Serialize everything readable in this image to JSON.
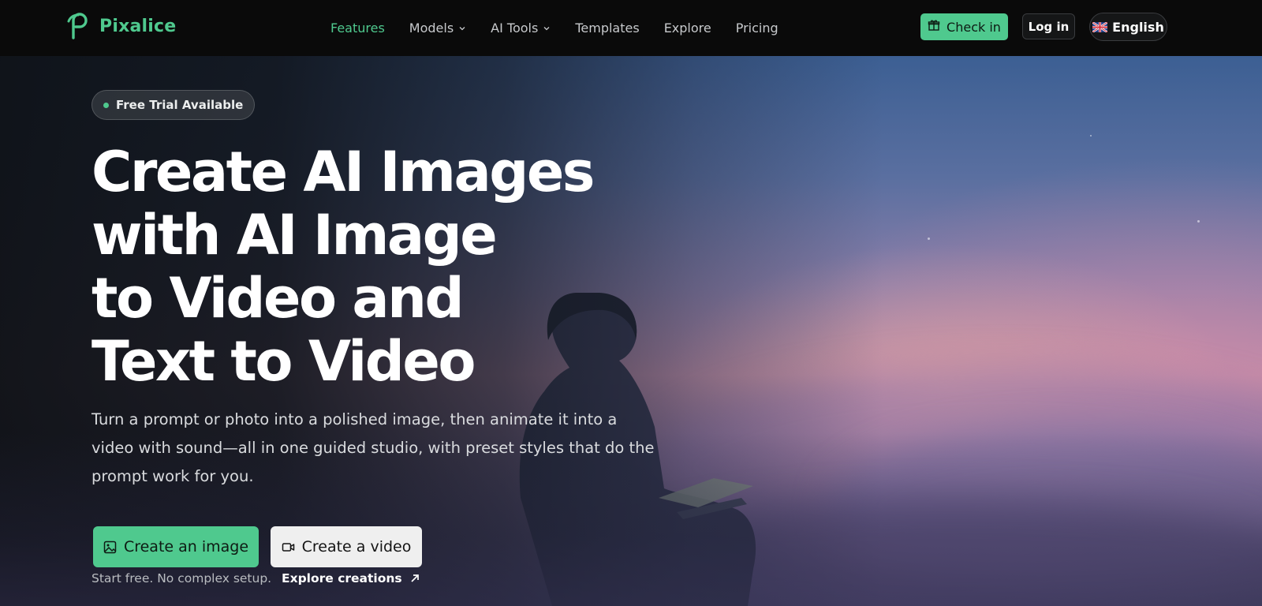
{
  "brand": {
    "name": "Pixalice",
    "accent": "#4fc98e"
  },
  "nav": {
    "links": [
      {
        "label": "Features",
        "active": true,
        "dropdown": false
      },
      {
        "label": "Models",
        "active": false,
        "dropdown": true
      },
      {
        "label": "AI Tools",
        "active": false,
        "dropdown": true
      },
      {
        "label": "Templates",
        "active": false,
        "dropdown": false
      },
      {
        "label": "Explore",
        "active": false,
        "dropdown": false
      },
      {
        "label": "Pricing",
        "active": false,
        "dropdown": false
      }
    ],
    "checkin_label": "Check in",
    "login_label": "Log in",
    "language_label": "English"
  },
  "hero": {
    "badge": "Free Trial Available",
    "headline_lines": [
      "Create AI Images",
      "with AI Image",
      "to Video and",
      "Text to Video"
    ],
    "subtitle": "Turn a prompt or photo into a polished image, then animate it into a video with sound—all in one guided studio, with preset styles that do the prompt work for you.",
    "create_image_label": "Create an image",
    "create_video_label": "Create a video",
    "footnote": "Start free. No complex setup.",
    "explore_label": "Explore creations"
  },
  "icons": {
    "logo": "pixalice-logo-icon",
    "checkin": "gift-icon",
    "language": "uk-flag-icon",
    "dropdown": "chevron-down-icon",
    "create_image": "image-icon",
    "create_video": "video-camera-icon",
    "explore": "arrow-up-right-icon"
  }
}
